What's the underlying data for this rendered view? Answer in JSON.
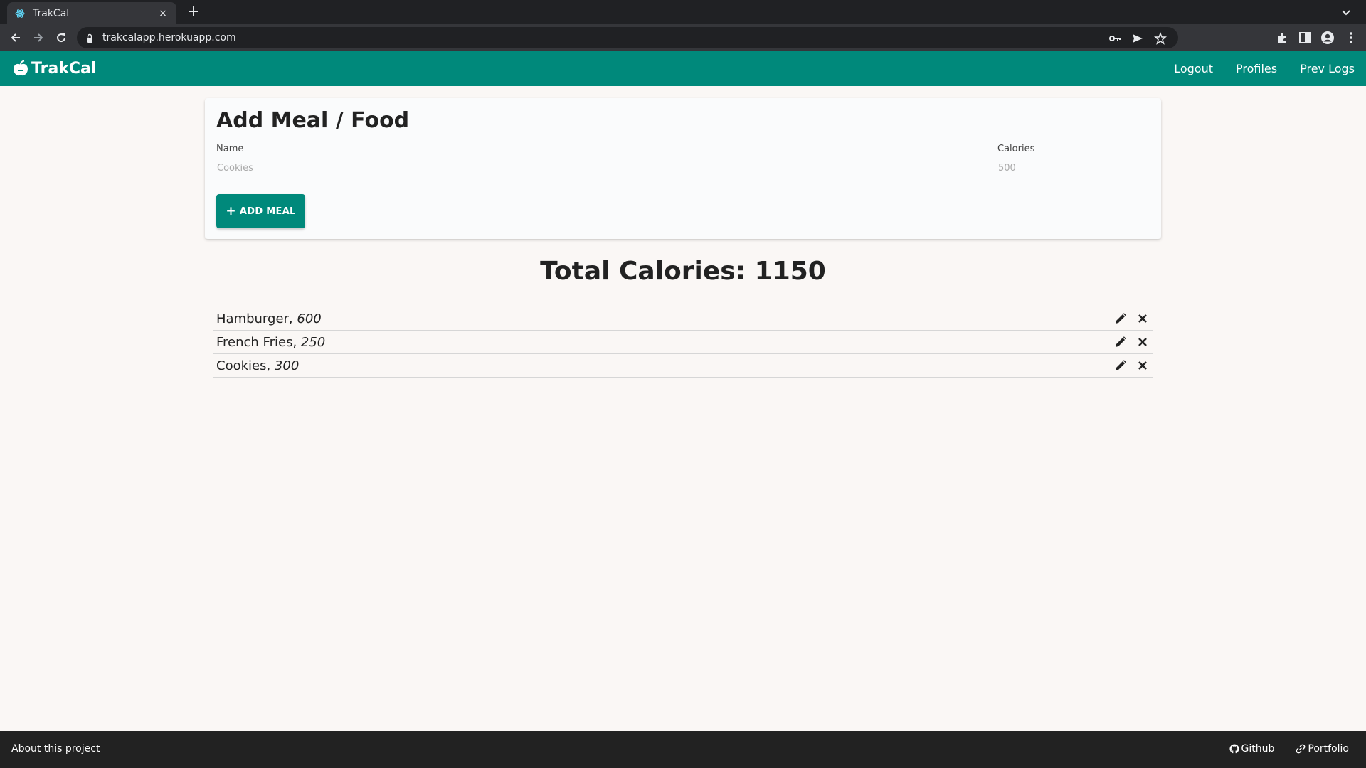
{
  "browser": {
    "tab_title": "TrakCal",
    "tab_close": "×",
    "new_tab": "+",
    "url": "trakcalapp.herokuapp.com"
  },
  "navbar": {
    "brand": "TrakCal",
    "links": [
      "Logout",
      "Profiles",
      "Prev Logs"
    ]
  },
  "form": {
    "title": "Add Meal / Food",
    "name_label": "Name",
    "name_placeholder": "Cookies",
    "calories_label": "Calories",
    "calories_placeholder": "500",
    "add_button_label": "ADD MEAL",
    "add_button_icon": "+"
  },
  "total": {
    "text": "Total Calories: 1150"
  },
  "meals": [
    {
      "name": "Hamburger, ",
      "calories": "600"
    },
    {
      "name": "French Fries, ",
      "calories": "250"
    },
    {
      "name": "Cookies, ",
      "calories": "300"
    }
  ],
  "footer": {
    "about": "About this project",
    "github": "Github",
    "portfolio": "Portfolio"
  },
  "colors": {
    "brand": "#00897b",
    "footer": "#222222",
    "background": "#faf7f5"
  }
}
